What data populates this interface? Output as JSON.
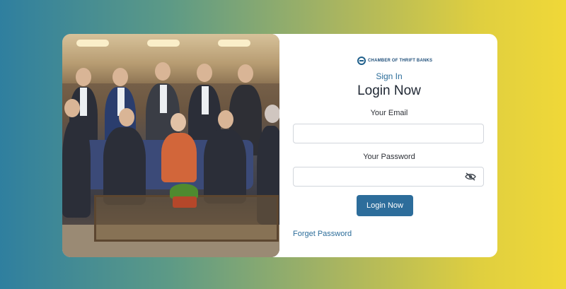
{
  "brand": {
    "logo_text": "CHAMBER OF THRIFT BANKS"
  },
  "form": {
    "heading_small": "Sign In",
    "heading": "Login Now",
    "email_label": "Your Email",
    "email_value": "",
    "password_label": "Your Password",
    "password_value": "",
    "submit_label": "Login Now",
    "forgot_link": "Forget Password",
    "password_toggle_icon": "eye-slash-icon"
  },
  "colors": {
    "accent": "#2d6d9b",
    "link": "#2c6d9a",
    "background_left": "#2f7f9f",
    "background_right": "#f0d838"
  }
}
